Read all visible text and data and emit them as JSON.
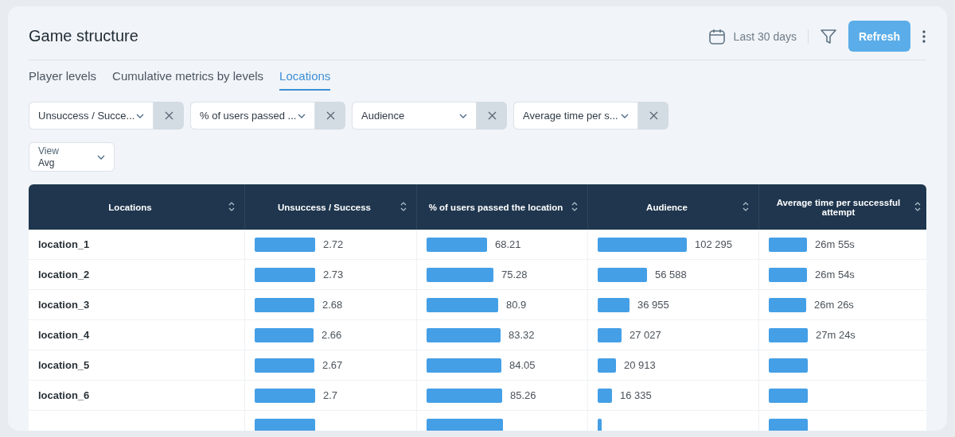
{
  "title": "Game structure",
  "date_range": "Last 30 days",
  "refresh_button": "Refresh",
  "tabs": [
    {
      "label": "Player levels",
      "selected": false
    },
    {
      "label": "Cumulative metrics by levels",
      "selected": false
    },
    {
      "label": "Locations",
      "selected": true
    }
  ],
  "metric_selectors": [
    {
      "value": "Unsuccess / Succe..."
    },
    {
      "value": "% of users passed ..."
    },
    {
      "value": "Audience"
    },
    {
      "value": "Average time per s..."
    }
  ],
  "view_select": {
    "label": "View",
    "value": "Avg"
  },
  "table": {
    "columns": [
      "Locations",
      "Unsuccess / Success",
      "% of users passed the location",
      "Audience",
      "Average time per successful attempt"
    ],
    "rows": [
      {
        "cells": [
          "location_1",
          "2.72",
          "68.21",
          "102 295",
          "26m 55s"
        ]
      },
      {
        "cells": [
          "location_2",
          "2.73",
          "75.28",
          "56 588",
          "26m 54s"
        ]
      },
      {
        "cells": [
          "location_3",
          "2.68",
          "80.9",
          "36 955",
          "26m 26s"
        ]
      },
      {
        "cells": [
          "location_4",
          "2.66",
          "83.32",
          "27 027",
          "27m 24s"
        ]
      },
      {
        "cells": [
          "location_5",
          "2.67",
          "84.05",
          "20 913",
          null
        ]
      },
      {
        "cells": [
          "location_6",
          "2.7",
          "85.26",
          "16 335",
          null
        ]
      },
      {
        "cells": [
          null,
          null,
          null,
          null,
          null
        ]
      }
    ]
  }
}
